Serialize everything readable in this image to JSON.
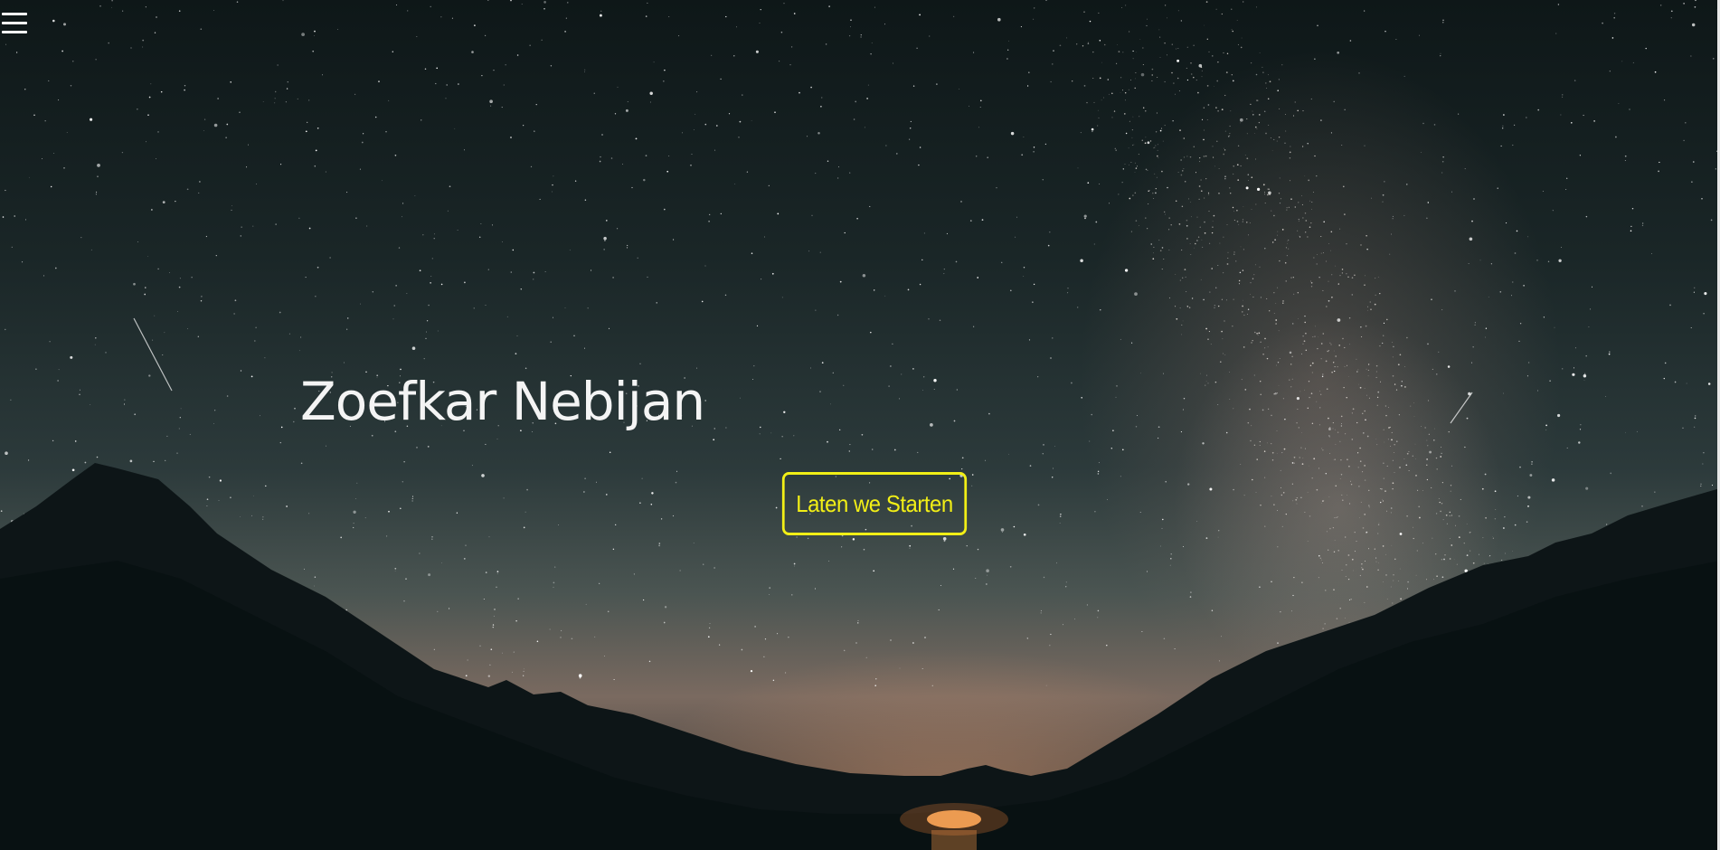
{
  "header": {
    "menu_icon": "hamburger-menu-icon"
  },
  "hero": {
    "title": "Zoefkar Nebijan",
    "cta_label": "Laten we Starten",
    "accent_color": "#f2ef16",
    "title_color": "#f4f4f4"
  }
}
